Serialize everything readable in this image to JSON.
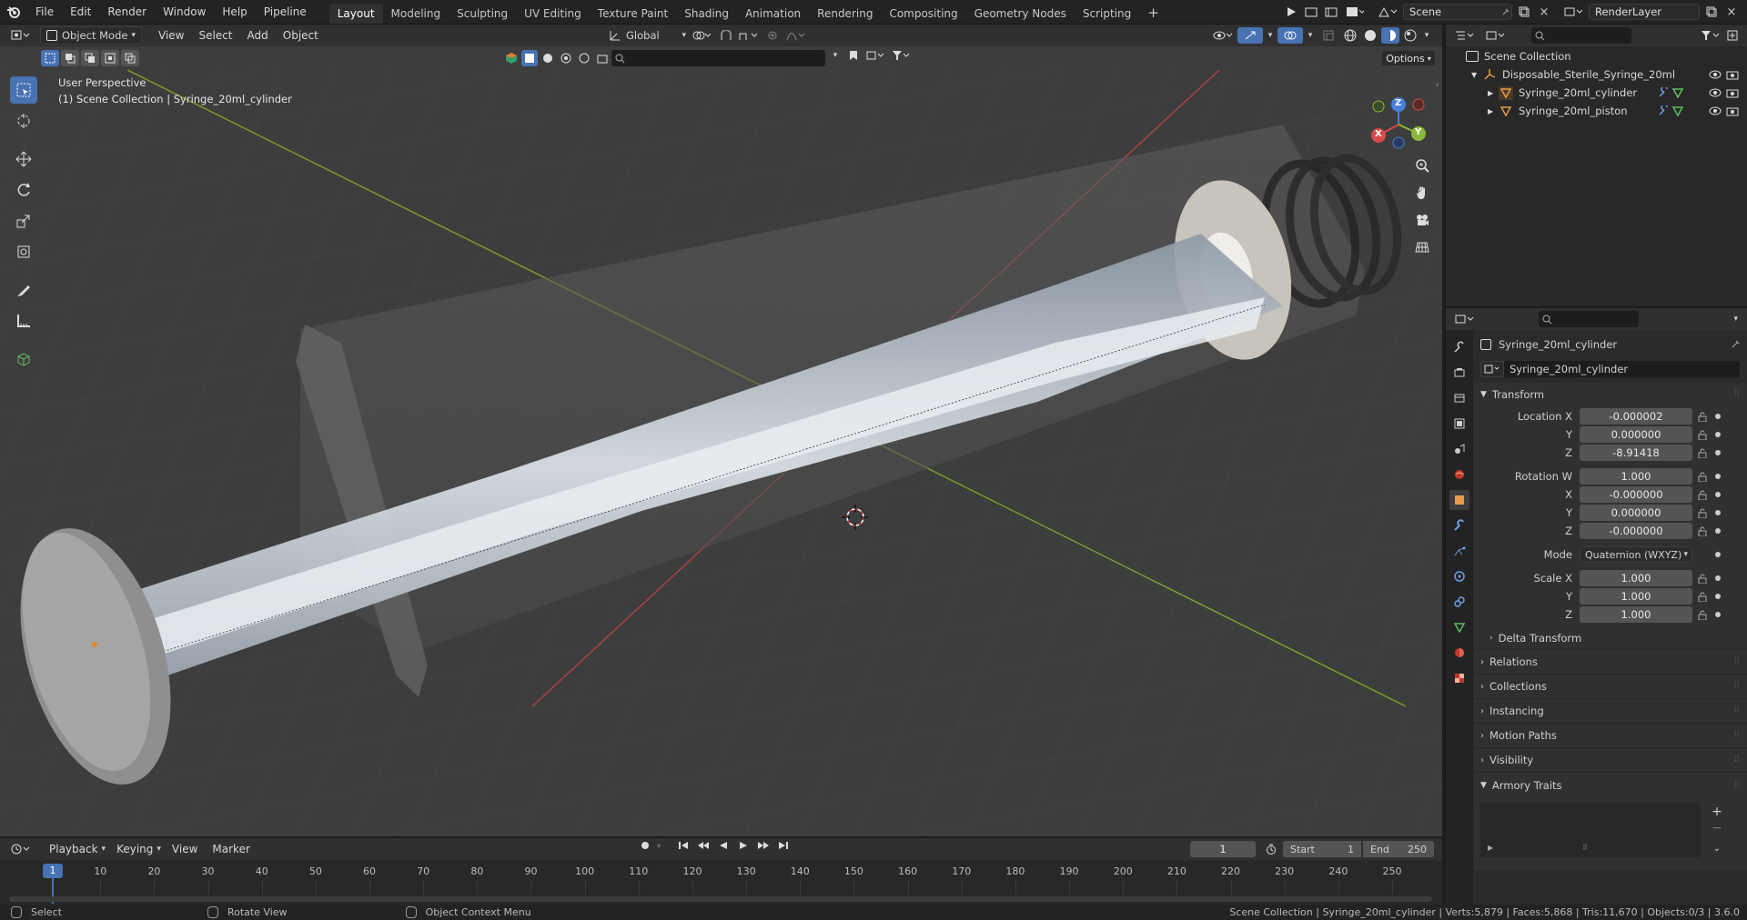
{
  "topbar": {
    "menus": [
      "File",
      "Edit",
      "Render",
      "Window",
      "Help",
      "Pipeline"
    ],
    "workspaces": [
      "Layout",
      "Modeling",
      "Sculpting",
      "UV Editing",
      "Texture Paint",
      "Shading",
      "Animation",
      "Rendering",
      "Compositing",
      "Geometry Nodes",
      "Scripting"
    ],
    "active_workspace": "Layout",
    "scene_name": "Scene",
    "view_layer": "RenderLayer"
  },
  "viewport_header": {
    "mode": "Object Mode",
    "menus": [
      "View",
      "Select",
      "Add",
      "Object"
    ],
    "orientation": "Global",
    "options_label": "Options"
  },
  "viewport": {
    "view_name": "User Perspective",
    "collection_info": "(1) Scene Collection | Syringe_20ml_cylinder",
    "gizmo_axes": {
      "x": "X",
      "y": "Y",
      "z": "Z"
    }
  },
  "outliner": {
    "root": "Scene Collection",
    "items": [
      {
        "name": "Disposable_Sterile_Syringe_20ml",
        "level": 1
      },
      {
        "name": "Syringe_20ml_cylinder",
        "level": 2
      },
      {
        "name": "Syringe_20ml_piston",
        "level": 2
      }
    ]
  },
  "properties": {
    "object_name": "Syringe_20ml_cylinder",
    "datablock_name": "Syringe_20ml_cylinder",
    "transform_title": "Transform",
    "location": {
      "label_x": "Location X",
      "x": "-0.000002",
      "y": "0.000000",
      "z": "-8.91418"
    },
    "rotation": {
      "label_w": "Rotation W",
      "w": "1.000",
      "x": "-0.000000",
      "y": "0.000000",
      "z": "-0.000000"
    },
    "mode_label": "Mode",
    "mode_value": "Quaternion (WXYZ)",
    "scale": {
      "label_x": "Scale X",
      "x": "1.000",
      "y": "1.000",
      "z": "1.000"
    },
    "axis_labels": {
      "y": "Y",
      "z": "Z",
      "x": "X"
    },
    "delta_transform": "Delta Transform",
    "sections": [
      "Relations",
      "Collections",
      "Instancing",
      "Motion Paths",
      "Visibility",
      "Armory Traits"
    ]
  },
  "timeline": {
    "menus": [
      "Playback",
      "Keying",
      "View",
      "Marker"
    ],
    "current_frame": "1",
    "start_label": "Start",
    "start": "1",
    "end_label": "End",
    "end": "250",
    "ticks": [
      "1",
      "10",
      "20",
      "30",
      "40",
      "50",
      "60",
      "70",
      "80",
      "90",
      "100",
      "110",
      "120",
      "130",
      "140",
      "150",
      "160",
      "170",
      "180",
      "190",
      "200",
      "210",
      "220",
      "230",
      "240",
      "250"
    ]
  },
  "statusbar": {
    "select": "Select",
    "rotate": "Rotate View",
    "context": "Object Context Menu",
    "stats": "Scene Collection | Syringe_20ml_cylinder | Verts:5,879 | Faces:5,868 | Tris:11,670 | Objects:0/3 | 3.6.0"
  },
  "colors": {
    "accent": "#4772b3",
    "x_axis": "#d94a4a",
    "y_axis": "#8ab83a",
    "z_axis": "#4a7fd9",
    "active_frame": "#4772b3"
  }
}
